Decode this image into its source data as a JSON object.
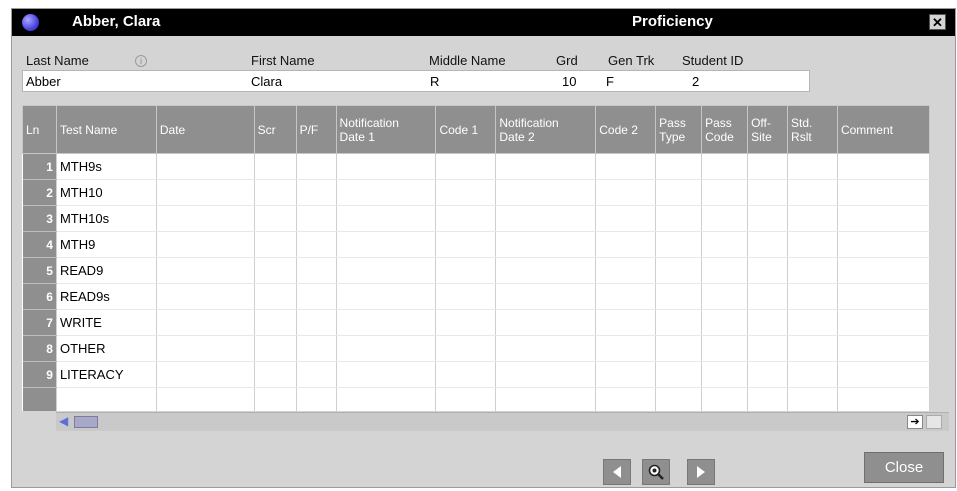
{
  "window": {
    "title_left": "Abber, Clara",
    "title_center": "Proficiency",
    "close_glyph": "✕"
  },
  "student": {
    "labels": {
      "last_name": "Last Name",
      "first_name": "First Name",
      "middle_name": "Middle Name",
      "grade": "Grd",
      "gender": "Gen",
      "track": "Trk",
      "student_id": "Student ID"
    },
    "values": {
      "last_name": "Abber",
      "first_name": "Clara",
      "middle_name": "R",
      "grade": "10",
      "gender": "F",
      "track": "",
      "student_id": "2"
    }
  },
  "grid": {
    "columns": [
      "Ln",
      "Test Name",
      "Date",
      "Scr",
      "P/F",
      "Notification\nDate 1",
      "Code 1",
      "Notification\nDate 2",
      "Code 2",
      "Pass\nType",
      "Pass\nCode",
      "Off-\nSite",
      "Std.\nRslt",
      "Comment"
    ],
    "rows": [
      [
        "1",
        "MTH9s"
      ],
      [
        "2",
        "MTH10"
      ],
      [
        "3",
        "MTH10s"
      ],
      [
        "4",
        "MTH9"
      ],
      [
        "5",
        "READ9"
      ],
      [
        "6",
        "READ9s"
      ],
      [
        "7",
        "WRITE"
      ],
      [
        "8",
        "OTHER"
      ],
      [
        "9",
        "LITERACY"
      ],
      [
        "",
        ""
      ]
    ]
  },
  "icons": {
    "app": "globe-icon",
    "scroll_left": "arrow-left-icon",
    "scroll_right": "arrow-right-icon",
    "nav_prev": "triangle-left-icon",
    "nav_search": "magnifier-icon",
    "nav_next": "triangle-right-icon"
  },
  "buttons": {
    "close": "Close"
  },
  "colors": {
    "titlebar": "#000000",
    "header_gray": "#8f8f8f",
    "window_bg": "#d4d4d4"
  }
}
